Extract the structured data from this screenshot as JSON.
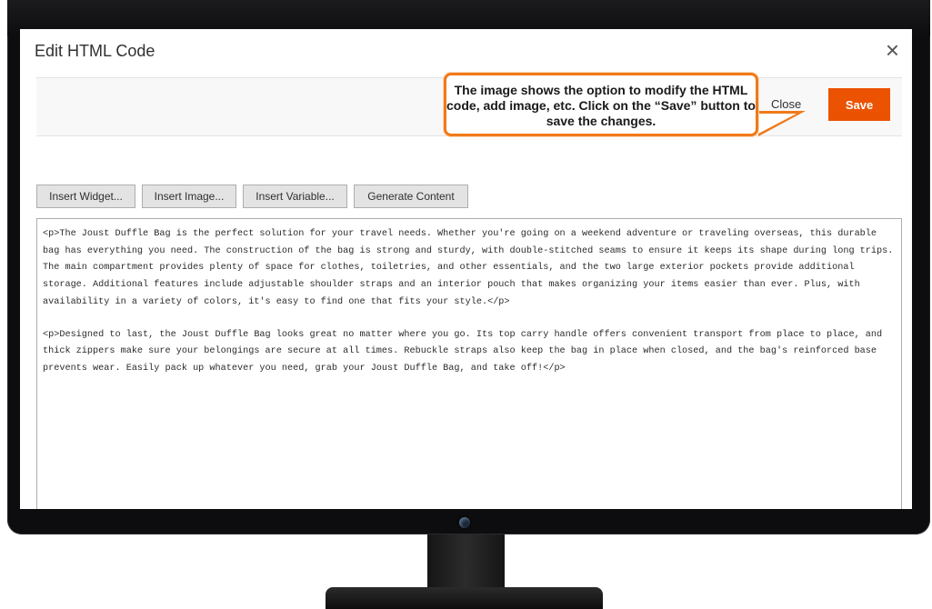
{
  "modal": {
    "title": "Edit HTML Code",
    "close_icon": "×",
    "close_label": "Close",
    "save_label": "Save"
  },
  "callout": {
    "text": "The image shows the option to modify the HTML code, add image, etc. Click on the “Save” button to save the changes."
  },
  "insert_buttons": {
    "widget": "Insert Widget...",
    "image": "Insert Image...",
    "variable": "Insert Variable...",
    "generate": "Generate Content"
  },
  "editor": {
    "paragraph_1": "<p>The Joust Duffle Bag is the perfect solution for your travel needs. Whether you're going on a weekend adventure or traveling overseas, this durable bag has everything you need. The construction of the bag is strong and sturdy, with double-stitched seams to ensure it keeps its shape during long trips.  The main compartment provides plenty of space for clothes, toiletries, and other essentials, and the two large exterior pockets provide additional storage. Additional features include adjustable shoulder straps and an interior pouch that makes organizing your items easier than ever. Plus, with availability in a variety of colors, it's easy to find one that fits your style.</p>",
    "paragraph_2": "<p>Designed to last, the Joust Duffle Bag looks great no matter where you go. Its top carry handle offers convenient transport from place to place, and thick zippers make sure your belongings are secure at all times. Rebuckle straps also keep the bag in place when closed, and the bag's reinforced base prevents wear. Easily pack up whatever you need, grab your Joust Duffle Bag, and take off!</p>"
  },
  "colors": {
    "accent": "#eb5202",
    "callout_border": "#f07a1a",
    "bezel": "#0d0d0f"
  }
}
